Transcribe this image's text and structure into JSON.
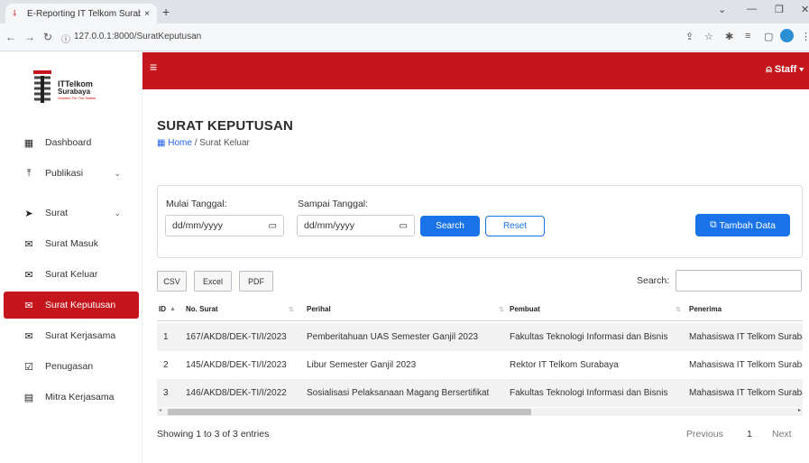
{
  "browser": {
    "tab_title": "E-Reporting IT Telkom Surabaya",
    "tab_close": "×",
    "new_tab": "+",
    "url": "127.0.0.1:8000/SuratKeputusan"
  },
  "brand": {
    "name_line1": "ITTelkom",
    "name_line2": "Surabaya",
    "tagline": "Solution For The Nation",
    "accent_color": "#c4161c"
  },
  "sidebar": {
    "items": [
      {
        "label": "Dashboard",
        "icon": "grid-icon"
      },
      {
        "label": "Publikasi",
        "icon": "upload-icon",
        "expandable": true
      },
      {
        "label": "Surat",
        "icon": "send-icon",
        "expandable": true
      },
      {
        "label": "Surat Masuk",
        "icon": "mail-icon"
      },
      {
        "label": "Surat Keluar",
        "icon": "mail-out-icon"
      },
      {
        "label": "Surat Keputusan",
        "icon": "mail-open-icon",
        "active": true
      },
      {
        "label": "Surat Kerjasama",
        "icon": "mail-icon"
      },
      {
        "label": "Penugasan",
        "icon": "clipboard-check-icon"
      },
      {
        "label": "Mitra Kerjasama",
        "icon": "id-card-icon"
      }
    ]
  },
  "header": {
    "user_label": "Staff"
  },
  "page": {
    "title": "SURAT KEPUTUSAN",
    "breadcrumb_home": "Home",
    "breadcrumb_current": "/ Surat Keluar"
  },
  "filter": {
    "start_label": "Mulai Tanggal:",
    "end_label": "Sampai Tanggal:",
    "start_placeholder": "dd/mm/yyyy",
    "end_placeholder": "dd/mm/yyyy",
    "search_button": "Search",
    "reset_button": "Reset",
    "add_button": "Tambah Data"
  },
  "toolbar": {
    "export_buttons": [
      "CSV",
      "Excel",
      "PDF"
    ],
    "search_label": "Search:",
    "search_value": ""
  },
  "table": {
    "columns": [
      "ID",
      "No. Surat",
      "Perihal",
      "Pembuat",
      "Penerima"
    ],
    "rows": [
      [
        "1",
        "167/AKD8/DEK-TI/I/2023",
        "Pemberitahuan UAS Semester Ganjil 2023",
        "Fakultas Teknologi Informasi dan Bisnis",
        "Mahasiswa IT Telkom Surabaya"
      ],
      [
        "2",
        "145/AKD8/DEK-TI/I/2023",
        "Libur Semester Ganjil 2023",
        "Rektor IT Telkom Surabaya",
        "Mahasiswa IT Telkom Surabaya"
      ],
      [
        "3",
        "146/AKD8/DEK-TI/I/2022",
        "Sosialisasi Pelaksanaan Magang Bersertifikat",
        "Fakultas Teknologi Informasi dan Bisnis",
        "Mahasiswa IT Telkom Surabaya"
      ]
    ]
  },
  "pagination": {
    "info": "Showing 1 to 3 of 3 entries",
    "previous": "Previous",
    "current_page": "1",
    "next": "Next"
  }
}
